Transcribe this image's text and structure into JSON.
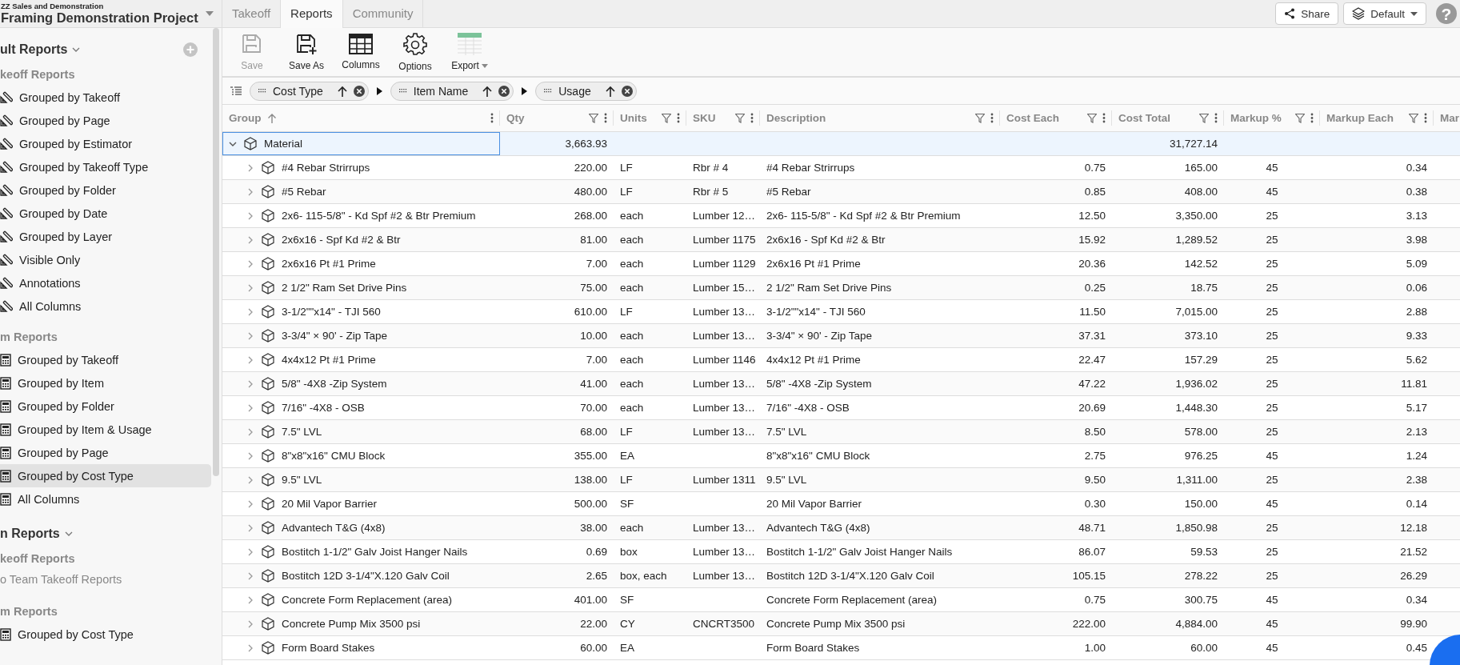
{
  "project": {
    "company": "ZZ Sales and Demonstration",
    "name": "Framing Demonstration Project"
  },
  "tabs": [
    {
      "label": "Takeoff",
      "selected": false
    },
    {
      "label": "Reports",
      "selected": true
    },
    {
      "label": "Community",
      "selected": false
    }
  ],
  "header_buttons": [
    {
      "kind": "share",
      "label": "Share"
    },
    {
      "kind": "layers",
      "label": "Default"
    }
  ],
  "help_label": "?",
  "sidebar": {
    "sections": [
      {
        "title": "ult Reports",
        "add_icon": true,
        "groups": [
          {
            "title": "keoff Reports",
            "kind": "takeoff",
            "items": [
              {
                "label": "Grouped by Takeoff",
                "selected": false
              },
              {
                "label": "Grouped by Page",
                "selected": false
              },
              {
                "label": "Grouped by Estimator",
                "selected": false
              },
              {
                "label": "Grouped by Takeoff Type",
                "selected": false
              },
              {
                "label": "Grouped by Folder",
                "selected": false
              },
              {
                "label": "Grouped by Date",
                "selected": false
              },
              {
                "label": "Grouped by Layer",
                "selected": false
              },
              {
                "label": "Visible Only",
                "selected": false
              },
              {
                "label": "Annotations",
                "selected": false
              },
              {
                "label": "All Columns",
                "selected": false
              }
            ]
          },
          {
            "title": "m Reports",
            "kind": "item",
            "items": [
              {
                "label": "Grouped by Takeoff",
                "selected": false
              },
              {
                "label": "Grouped by Item",
                "selected": false
              },
              {
                "label": "Grouped by Folder",
                "selected": false
              },
              {
                "label": "Grouped by Item & Usage",
                "selected": false
              },
              {
                "label": "Grouped by Page",
                "selected": false
              },
              {
                "label": "Grouped by Cost Type",
                "selected": true
              },
              {
                "label": "All Columns",
                "selected": false
              }
            ]
          }
        ]
      },
      {
        "title": "n Reports",
        "groups": [
          {
            "title": "keoff Reports",
            "empty_text": "o Team Takeoff Reports"
          },
          {
            "title": "m Reports",
            "kind": "item",
            "items": [
              {
                "label": "Grouped by Cost Type",
                "selected": false
              }
            ]
          }
        ]
      }
    ]
  },
  "toolbar": [
    {
      "kind": "save",
      "label": "Save",
      "disabled": true
    },
    {
      "kind": "save_as",
      "label": "Save As",
      "disabled": false
    },
    {
      "kind": "columns",
      "label": "Columns",
      "disabled": false
    },
    {
      "kind": "options",
      "label": "Options",
      "disabled": false
    },
    {
      "kind": "export",
      "label": "Export",
      "disabled": false
    }
  ],
  "grouping": [
    "Cost Type",
    "Item Name",
    "Usage"
  ],
  "columns": [
    {
      "label": "Group",
      "sorted": true,
      "filter": false
    },
    {
      "label": "Qty",
      "sorted": false,
      "filter": true
    },
    {
      "label": "Units",
      "sorted": false,
      "filter": true
    },
    {
      "label": "SKU",
      "sorted": false,
      "filter": true
    },
    {
      "label": "Description",
      "sorted": false,
      "filter": true
    },
    {
      "label": "Cost Each",
      "sorted": false,
      "filter": true
    },
    {
      "label": "Cost Total",
      "sorted": false,
      "filter": true
    },
    {
      "label": "Markup %",
      "sorted": false,
      "filter": true
    },
    {
      "label": "Markup Each",
      "sorted": false,
      "filter": true
    },
    {
      "label": "Mar"
    }
  ],
  "group_row": {
    "group": "Material",
    "qty": "3,663.93",
    "cost_total": "31,727.14",
    "expanded": true,
    "selected": true
  },
  "rows": [
    {
      "group": "#4 Rebar Strirrups",
      "qty": "220.00",
      "units": "LF",
      "sku": "Rbr # 4",
      "description": "#4 Rebar Strirrups",
      "cost_each": "0.75",
      "cost_total": "165.00",
      "markup_pct": "45",
      "markup_each": "0.34"
    },
    {
      "group": "#5 Rebar",
      "qty": "480.00",
      "units": "LF",
      "sku": "Rbr # 5",
      "description": "#5 Rebar",
      "cost_each": "0.85",
      "cost_total": "408.00",
      "markup_pct": "45",
      "markup_each": "0.38"
    },
    {
      "group": "2x6- 115-5/8\" - Kd Spf #2 & Btr Premium",
      "qty": "268.00",
      "units": "each",
      "sku": "Lumber 12…",
      "description": "2x6- 115-5/8\" - Kd Spf #2 & Btr Premium",
      "cost_each": "12.50",
      "cost_total": "3,350.00",
      "markup_pct": "25",
      "markup_each": "3.13"
    },
    {
      "group": "2x6x16 - Spf Kd #2 & Btr",
      "qty": "81.00",
      "units": "each",
      "sku": "Lumber 1175",
      "description": "2x6x16 - Spf Kd #2 & Btr",
      "cost_each": "15.92",
      "cost_total": "1,289.52",
      "markup_pct": "25",
      "markup_each": "3.98"
    },
    {
      "group": "2x6x16 Pt #1 Prime",
      "qty": "7.00",
      "units": "each",
      "sku": "Lumber 1129",
      "description": "2x6x16 Pt #1 Prime",
      "cost_each": "20.36",
      "cost_total": "142.52",
      "markup_pct": "25",
      "markup_each": "5.09"
    },
    {
      "group": "2 1/2\" Ram Set Drive Pins",
      "qty": "75.00",
      "units": "each",
      "sku": "Lumber 15…",
      "description": "2 1/2\" Ram Set Drive Pins",
      "cost_each": "0.25",
      "cost_total": "18.75",
      "markup_pct": "25",
      "markup_each": "0.06"
    },
    {
      "group": "3-1/2\"\"x14\" - TJI 560",
      "qty": "610.00",
      "units": "LF",
      "sku": "Lumber 13…",
      "description": "3-1/2\"\"x14\" - TJI 560",
      "cost_each": "11.50",
      "cost_total": "7,015.00",
      "markup_pct": "25",
      "markup_each": "2.88"
    },
    {
      "group": "3-3/4\" × 90' - Zip Tape",
      "qty": "10.00",
      "units": "each",
      "sku": "Lumber 13…",
      "description": "3-3/4\" × 90' - Zip Tape",
      "cost_each": "37.31",
      "cost_total": "373.10",
      "markup_pct": "25",
      "markup_each": "9.33"
    },
    {
      "group": "4x4x12 Pt #1 Prime",
      "qty": "7.00",
      "units": "each",
      "sku": "Lumber 1146",
      "description": "4x4x12 Pt #1 Prime",
      "cost_each": "22.47",
      "cost_total": "157.29",
      "markup_pct": "25",
      "markup_each": "5.62"
    },
    {
      "group": "5/8\" -4X8 -Zip System",
      "qty": "41.00",
      "units": "each",
      "sku": "Lumber 13…",
      "description": "5/8\" -4X8 -Zip System",
      "cost_each": "47.22",
      "cost_total": "1,936.02",
      "markup_pct": "25",
      "markup_each": "11.81"
    },
    {
      "group": "7/16\" -4X8 - OSB",
      "qty": "70.00",
      "units": "each",
      "sku": "Lumber 13…",
      "description": "7/16\" -4X8 - OSB",
      "cost_each": "20.69",
      "cost_total": "1,448.30",
      "markup_pct": "25",
      "markup_each": "5.17"
    },
    {
      "group": "7.5\" LVL",
      "qty": "68.00",
      "units": "LF",
      "sku": "Lumber 13…",
      "description": "7.5\" LVL",
      "cost_each": "8.50",
      "cost_total": "578.00",
      "markup_pct": "25",
      "markup_each": "2.13"
    },
    {
      "group": "8\"x8\"x16\" CMU Block",
      "qty": "355.00",
      "units": "EA",
      "description": "8\"x8\"x16\" CMU Block",
      "cost_each": "2.75",
      "cost_total": "976.25",
      "markup_pct": "45",
      "markup_each": "1.24"
    },
    {
      "group": "9.5\" LVL",
      "qty": "138.00",
      "units": "LF",
      "sku": "Lumber 1311",
      "description": "9.5\" LVL",
      "cost_each": "9.50",
      "cost_total": "1,311.00",
      "markup_pct": "25",
      "markup_each": "2.38"
    },
    {
      "group": "20 Mil Vapor Barrier",
      "qty": "500.00",
      "units": "SF",
      "description": "20 Mil Vapor Barrier",
      "cost_each": "0.30",
      "cost_total": "150.00",
      "markup_pct": "45",
      "markup_each": "0.14"
    },
    {
      "group": "Advantech T&G (4x8)",
      "qty": "38.00",
      "units": "each",
      "sku": "Lumber 13…",
      "description": "Advantech T&G (4x8)",
      "cost_each": "48.71",
      "cost_total": "1,850.98",
      "markup_pct": "25",
      "markup_each": "12.18"
    },
    {
      "group": "Bostitch 1-1/2\" Galv Joist Hanger Nails",
      "qty": "0.69",
      "units": "box",
      "sku": "Lumber 13…",
      "description": "Bostitch 1-1/2\" Galv Joist Hanger Nails",
      "cost_each": "86.07",
      "cost_total": "59.53",
      "markup_pct": "25",
      "markup_each": "21.52"
    },
    {
      "group": "Bostitch 12D 3-1/4\"X.120 Galv Coil",
      "qty": "2.65",
      "units": "box, each",
      "sku": "Lumber 13…",
      "description": "Bostitch 12D 3-1/4\"X.120 Galv Coil",
      "cost_each": "105.15",
      "cost_total": "278.22",
      "markup_pct": "25",
      "markup_each": "26.29"
    },
    {
      "group": "Concrete Form Replacement (area)",
      "qty": "401.00",
      "units": "SF",
      "description": "Concrete Form Replacement (area)",
      "cost_each": "0.75",
      "cost_total": "300.75",
      "markup_pct": "45",
      "markup_each": "0.34"
    },
    {
      "group": "Concrete Pump Mix 3500 psi",
      "qty": "22.00",
      "units": "CY",
      "sku": "CNCRT3500",
      "description": "Concrete Pump Mix 3500 psi",
      "cost_each": "222.00",
      "cost_total": "4,884.00",
      "markup_pct": "45",
      "markup_each": "99.90"
    },
    {
      "group": "Form Board Stakes",
      "qty": "60.00",
      "units": "EA",
      "description": "Form Board Stakes",
      "cost_each": "1.00",
      "cost_total": "60.00",
      "markup_pct": "45",
      "markup_each": "0.45"
    }
  ]
}
